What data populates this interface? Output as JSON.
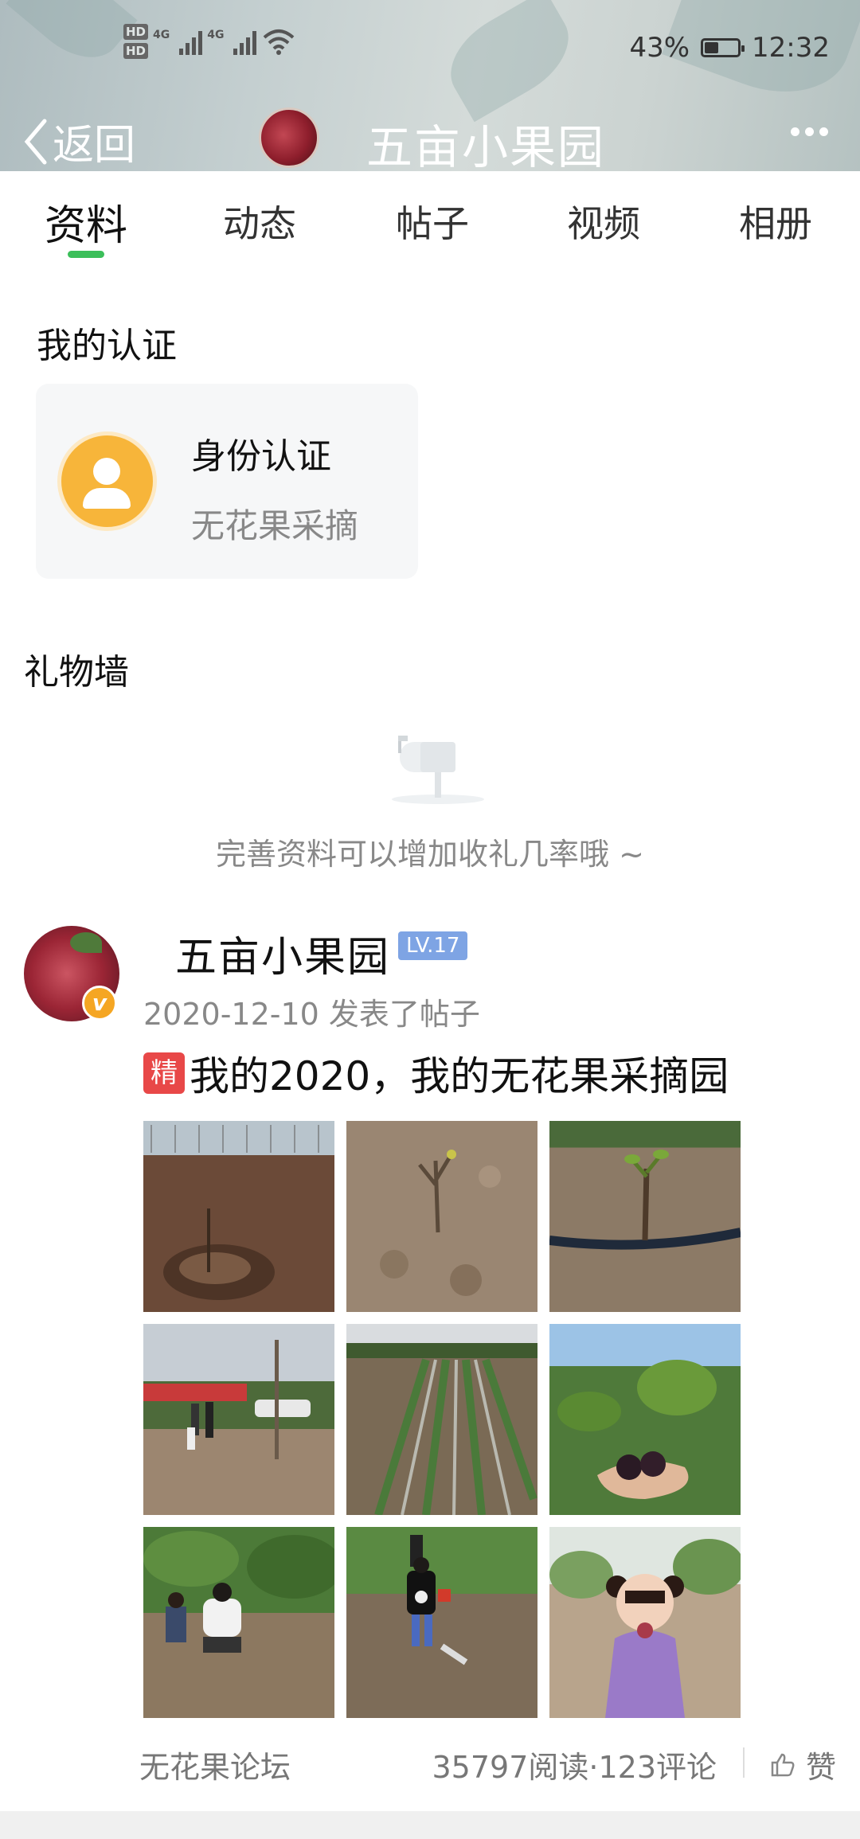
{
  "status_bar": {
    "hd1": "HD",
    "hd2": "HD",
    "net1": "4G",
    "net2": "4G",
    "battery_percent": "43%",
    "battery_level": 0.43,
    "time": "12:32"
  },
  "header": {
    "back_label": "返回",
    "title": "五亩小果园"
  },
  "tabs": [
    {
      "label": "资料",
      "active": true
    },
    {
      "label": "动态",
      "active": false
    },
    {
      "label": "帖子",
      "active": false
    },
    {
      "label": "视频",
      "active": false
    },
    {
      "label": "相册",
      "active": false
    }
  ],
  "certification": {
    "section_title": "我的认证",
    "card_title": "身份认证",
    "card_subtitle": "无花果采摘"
  },
  "gift_wall": {
    "section_title": "礼物墙",
    "empty_text": "完善资料可以增加收礼几率哦 ~"
  },
  "post": {
    "author": "五亩小果园",
    "level": "LV.17",
    "verified_badge": "v",
    "meta": "2020-12-10 发表了帖子",
    "essence_tag": "精",
    "title": "我的2020，我的无花果采摘园",
    "forum": "无花果论坛",
    "stats": "35797阅读·123评论",
    "like_label": "赞"
  },
  "colors": {
    "tab_indicator": "#3cbf5a",
    "level_badge": "#7ea4e4",
    "essence_tag": "#e84848",
    "verified_badge": "#f5a623",
    "auth_icon": "#f7b53a"
  }
}
